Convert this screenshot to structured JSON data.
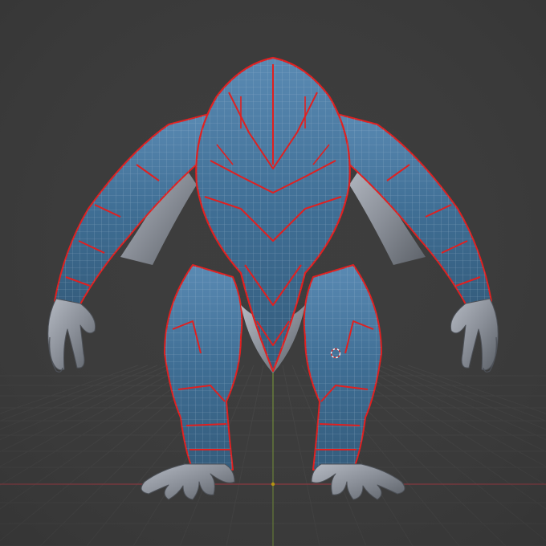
{
  "viewport": {
    "background_color": "#3d3d3d",
    "grid_color": "#474747",
    "x_axis_color": "#b33a45",
    "y_axis_color": "#7fa03a",
    "origin_color": "#f0c000"
  },
  "model": {
    "skin_color": "#3f6e94",
    "wire_color": "#9cb3c8",
    "seam_color": "#e02020",
    "clay_color": "#8a8f98"
  },
  "icons": [
    "3d-cursor-icon"
  ]
}
